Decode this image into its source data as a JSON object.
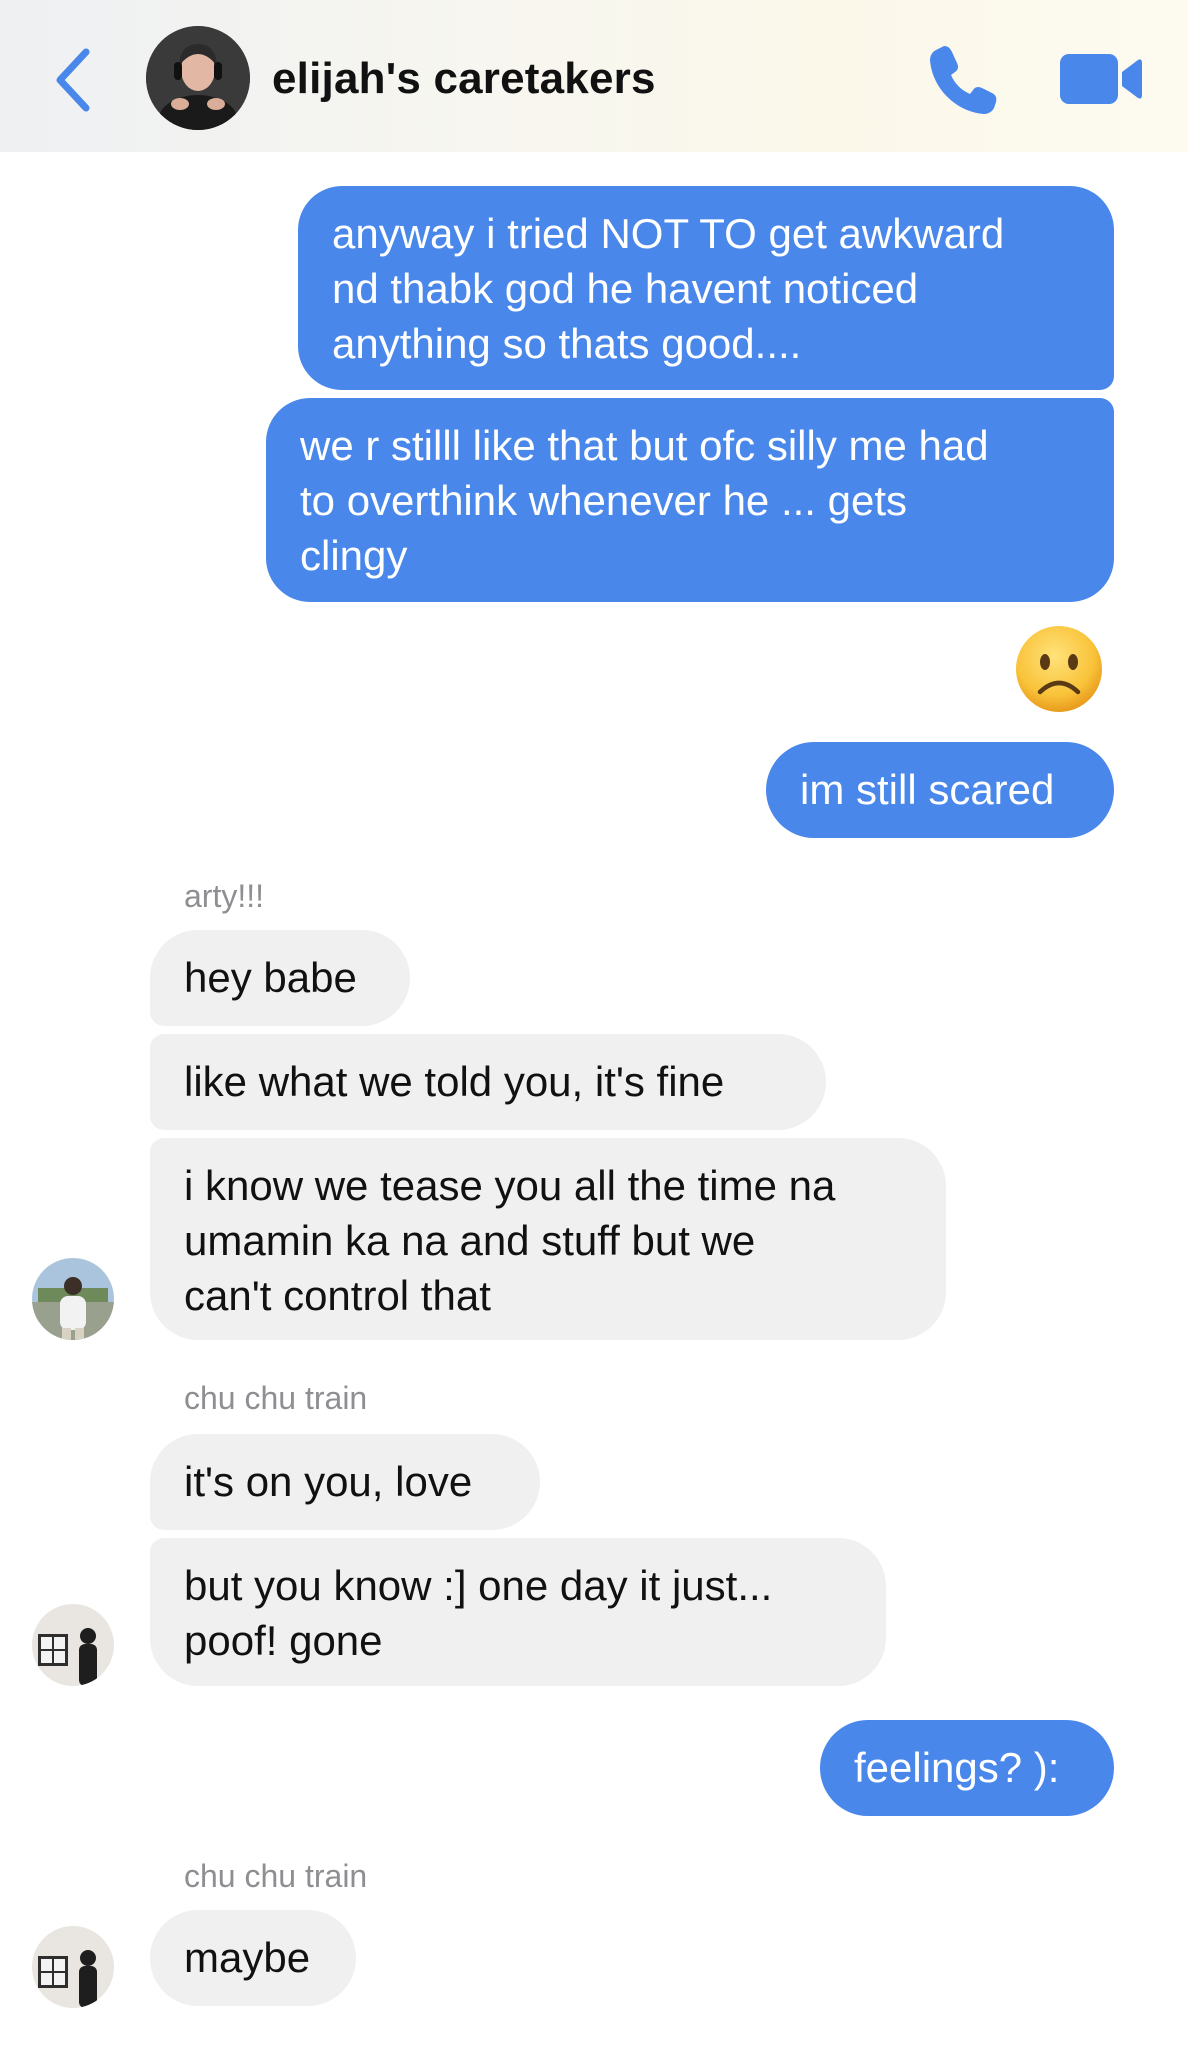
{
  "header": {
    "title": "elijah's caretakers",
    "back_icon": "chevron-left-icon",
    "call_icon": "phone-icon",
    "video_icon": "video-camera-icon",
    "accent_color": "#4a87eb"
  },
  "messages": [
    {
      "direction": "outgoing",
      "text": "anyway i tried NOT TO get awkward\nnd thabk god he havent noticed\nanything so thats good...."
    },
    {
      "direction": "outgoing",
      "text": "we r stilll like that but ofc silly me had\nto overthink whenever he ... gets\nclingy"
    },
    {
      "direction": "outgoing",
      "type": "emoji",
      "emoji": "sad-face-emoji"
    },
    {
      "direction": "outgoing",
      "text": "im still scared"
    },
    {
      "direction": "incoming",
      "sender": "arty!!!",
      "text": "hey babe"
    },
    {
      "direction": "incoming",
      "sender": "arty!!!",
      "text": "like what we told you, it's fine"
    },
    {
      "direction": "incoming",
      "sender": "arty!!!",
      "text": "i know we tease you all the time na\numamin ka na and stuff but we\ncan't control that"
    },
    {
      "direction": "incoming",
      "sender": "chu chu train",
      "text": "it's on you, love"
    },
    {
      "direction": "incoming",
      "sender": "chu chu train",
      "text": "but you know :] one day it just...\npoof! gone"
    },
    {
      "direction": "outgoing",
      "text": "feelings? ):"
    },
    {
      "direction": "incoming",
      "sender": "chu chu train",
      "text": "maybe"
    }
  ],
  "colors": {
    "outgoing_bubble": "#4a87eb",
    "incoming_bubble": "#f0f0f0",
    "sender_name": "#8e8e93"
  }
}
